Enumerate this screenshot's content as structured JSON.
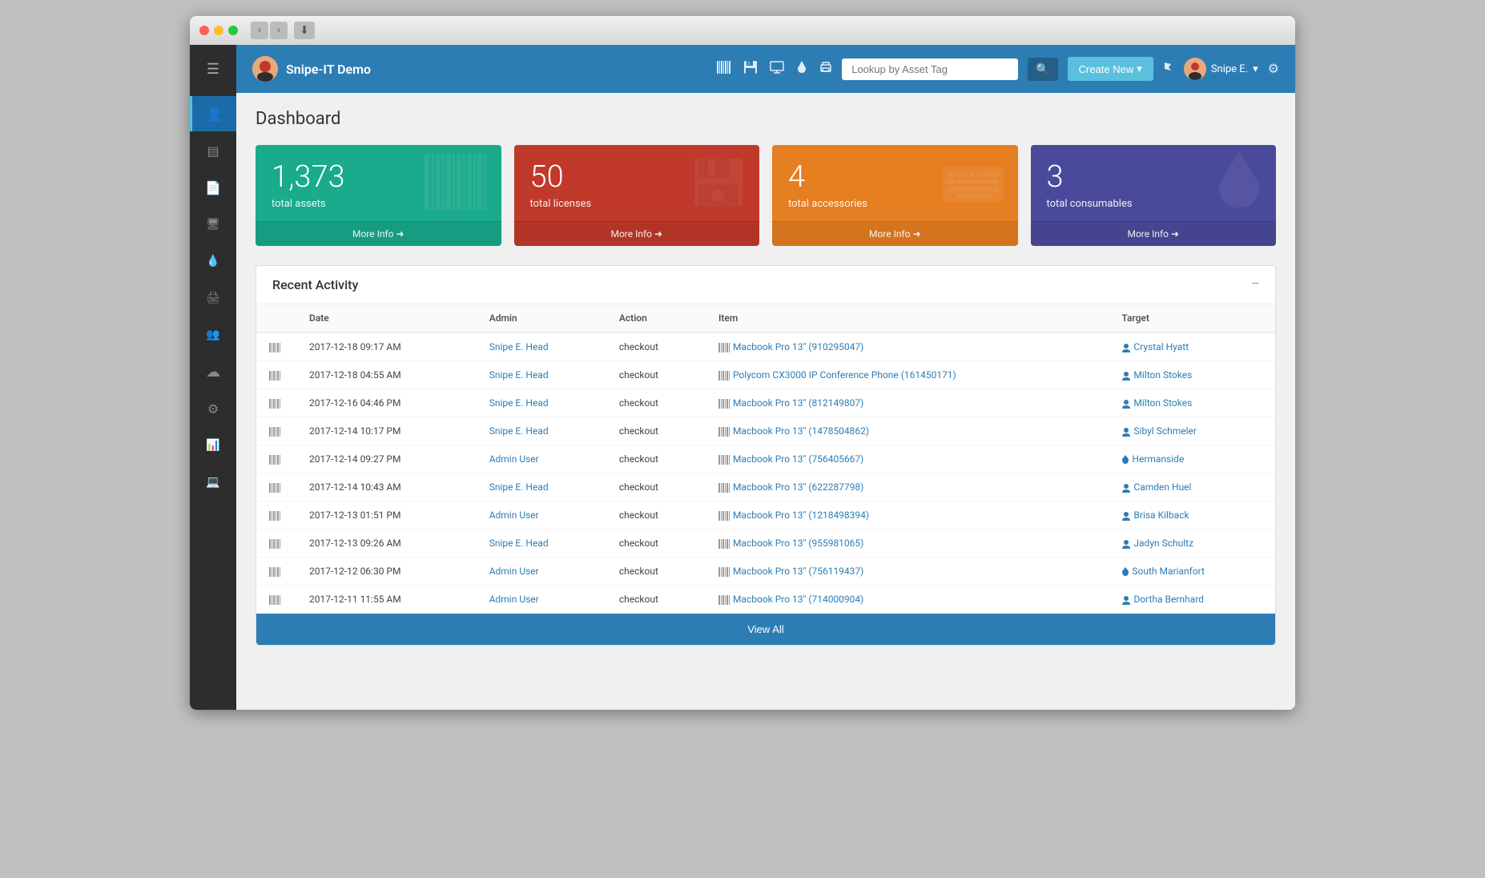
{
  "window": {
    "title": "Snipe-IT Demo"
  },
  "brand": {
    "name": "Snipe-IT Demo"
  },
  "topnav": {
    "search_placeholder": "Lookup by Asset Tag",
    "create_new": "Create New",
    "user_name": "Snipe E.",
    "icons": [
      "barcode",
      "floppy",
      "display",
      "tint",
      "print"
    ]
  },
  "page": {
    "title": "Dashboard"
  },
  "stats": [
    {
      "value": "1,373",
      "label": "total assets",
      "more": "More Info",
      "color": "teal",
      "icon": "barcode"
    },
    {
      "value": "50",
      "label": "total licenses",
      "more": "More Info",
      "color": "red",
      "icon": "floppy"
    },
    {
      "value": "4",
      "label": "total accessories",
      "more": "More Info",
      "color": "orange",
      "icon": "keyboard"
    },
    {
      "value": "3",
      "label": "total consumables",
      "more": "More Info",
      "color": "purple",
      "icon": "tint"
    }
  ],
  "activity": {
    "title": "Recent Activity",
    "columns": [
      "Date",
      "Admin",
      "Action",
      "Item",
      "Target"
    ],
    "rows": [
      {
        "date": "2017-12-18 09:17 AM",
        "admin": "Snipe E. Head",
        "action": "checkout",
        "item": "Macbook Pro 13\" (910295047)",
        "target": "Crystal Hyatt",
        "target_type": "person"
      },
      {
        "date": "2017-12-18 04:55 AM",
        "admin": "Snipe E. Head",
        "action": "checkout",
        "item": "Polycom CX3000 IP Conference Phone (161450171)",
        "target": "Milton Stokes",
        "target_type": "person"
      },
      {
        "date": "2017-12-16 04:46 PM",
        "admin": "Snipe E. Head",
        "action": "checkout",
        "item": "Macbook Pro 13\" (812149807)",
        "target": "Milton Stokes",
        "target_type": "person"
      },
      {
        "date": "2017-12-14 10:17 PM",
        "admin": "Snipe E. Head",
        "action": "checkout",
        "item": "Macbook Pro 13\" (1478504862)",
        "target": "Sibyl Schmeler",
        "target_type": "person"
      },
      {
        "date": "2017-12-14 09:27 PM",
        "admin": "Admin User",
        "action": "checkout",
        "item": "Macbook Pro 13\" (756405667)",
        "target": "Hermanside",
        "target_type": "location"
      },
      {
        "date": "2017-12-14 10:43 AM",
        "admin": "Snipe E. Head",
        "action": "checkout",
        "item": "Macbook Pro 13\" (622287798)",
        "target": "Camden Huel",
        "target_type": "person"
      },
      {
        "date": "2017-12-13 01:51 PM",
        "admin": "Admin User",
        "action": "checkout",
        "item": "Macbook Pro 13\" (1218498394)",
        "target": "Brisa Kilback",
        "target_type": "person"
      },
      {
        "date": "2017-12-13 09:26 AM",
        "admin": "Snipe E. Head",
        "action": "checkout",
        "item": "Macbook Pro 13\" (955981065)",
        "target": "Jadyn Schultz",
        "target_type": "person"
      },
      {
        "date": "2017-12-12 06:30 PM",
        "admin": "Admin User",
        "action": "checkout",
        "item": "Macbook Pro 13\" (756119437)",
        "target": "South Marianfort",
        "target_type": "location"
      },
      {
        "date": "2017-12-11 11:55 AM",
        "admin": "Admin User",
        "action": "checkout",
        "item": "Macbook Pro 13\" (714000904)",
        "target": "Dortha Bernhard",
        "target_type": "person"
      }
    ],
    "view_all": "View All"
  },
  "sidebar": {
    "items": [
      {
        "icon": "bars",
        "label": "Menu",
        "active": false
      },
      {
        "icon": "user",
        "label": "Dashboard",
        "active": true
      },
      {
        "icon": "layers",
        "label": "Assets",
        "active": false
      },
      {
        "icon": "file",
        "label": "Licenses",
        "active": false
      },
      {
        "icon": "monitor",
        "label": "Accessories",
        "active": false
      },
      {
        "icon": "tint",
        "label": "Consumables",
        "active": false
      },
      {
        "icon": "print",
        "label": "Components",
        "active": false
      },
      {
        "icon": "users",
        "label": "People",
        "active": false
      },
      {
        "icon": "cloud",
        "label": "Cloud",
        "active": false
      },
      {
        "icon": "gear",
        "label": "Settings",
        "active": false
      },
      {
        "icon": "chart",
        "label": "Reports",
        "active": false
      },
      {
        "icon": "laptop",
        "label": "Assets",
        "active": false
      }
    ]
  }
}
